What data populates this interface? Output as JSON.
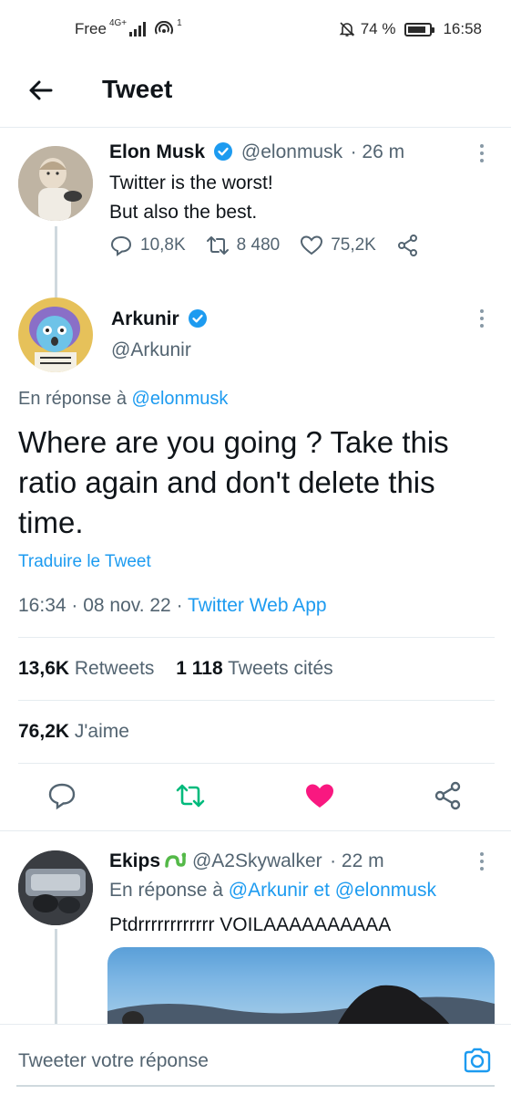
{
  "status_bar": {
    "carrier": "Free",
    "network": "4G+",
    "hotspot_badge": "1",
    "battery": "74 %",
    "time": "16:58"
  },
  "header": {
    "title": "Tweet"
  },
  "parent_tweet": {
    "name": "Elon Musk",
    "handle": "@elonmusk",
    "time": "· 26 m",
    "line1": "Twitter is the worst!",
    "line2": "But also the best.",
    "replies": "10,8K",
    "retweets": "8 480",
    "likes": "75,2K"
  },
  "main_tweet": {
    "name": "Arkunir",
    "handle": "@Arkunir",
    "reply_prefix": "En réponse à ",
    "reply_to": "@elonmusk",
    "text": "Where are you going ? Take this ratio again and don't delete this time.",
    "translate": "Traduire le Tweet",
    "timestamp": "16:34 · 08 nov. 22 · ",
    "source": "Twitter Web App",
    "retweets_count": "13,6K",
    "retweets_label": " Retweets",
    "quotes_count": "1 118",
    "quotes_label": " Tweets cités",
    "likes_count": "76,2K",
    "likes_label": " J'aime"
  },
  "reply_tweet": {
    "name": "Ekips",
    "handle": "@A2Skywalker",
    "time": "· 22 m",
    "reply_prefix": "En réponse à ",
    "reply_to": "@Arkunir et @elonmusk",
    "text": "Ptdrrrrrrrrrrrr VOILAAAAAAAAAA"
  },
  "compose": {
    "placeholder": "Tweeter votre réponse"
  },
  "colors": {
    "accent": "#1d9bf0",
    "like": "#f91880",
    "retweet": "#00ba7c",
    "muted": "#536471"
  }
}
